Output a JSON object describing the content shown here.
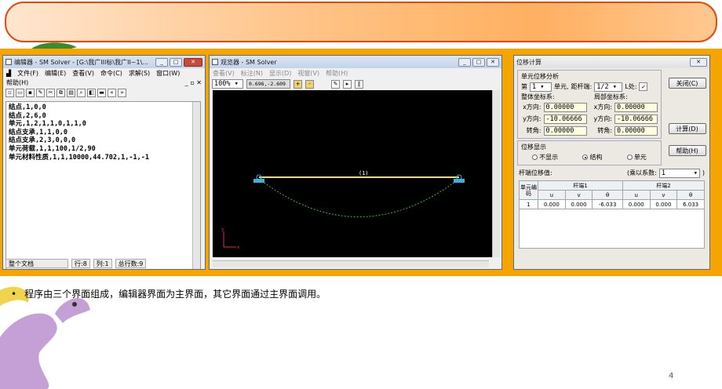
{
  "slide": {
    "bullet_text": "程序由三个界面组成，编辑器界面为主界面，其它界面通过主界面调用。",
    "page_number": "4",
    "colors": {
      "strip": "#f6a400",
      "title_border": "#e04a10",
      "dino": "#c5a0d6"
    }
  },
  "editor": {
    "title": "编辑器 - SM Solver - [G:\\我广III标\\我广II~1\\...",
    "menu": [
      "文件(F)",
      "编辑(E)",
      "查看(V)",
      "命令(C)",
      "求解(S)",
      "窗口(W)"
    ],
    "menu2": "帮助(H)",
    "lines": [
      "结点,1,0,0",
      "结点,2,6,0",
      "单元,1,2,1,1,0,1,1,0",
      "结点支承,1,1,0,0",
      "结点支承,2,3,0,0,0",
      "单元荷载,1,1,100,1/2,90",
      "单元材料性质,1,1,10000,44.702,1,-1,-1"
    ],
    "status": {
      "doc": "整个文档",
      "row": "行:8",
      "col": "列:1",
      "total": "总行数:9"
    }
  },
  "viewer": {
    "title": "观览器 - SM Solver",
    "menu": [
      "查看(V)",
      "标注(N)",
      "显示(D)",
      "视窗(V)",
      "帮助(H)"
    ],
    "zoom": "100%",
    "coords": "0.696,-2.609",
    "element_label": "(1)",
    "axis_y": "y",
    "axis_x": "x"
  },
  "calc": {
    "title": "位移计算",
    "group1_title": "单元位移分析",
    "elem_prefix": "第",
    "elem_value": "1",
    "elem_suffix": "单元,",
    "dist_label": "距杆端:",
    "dist_value": "1/2",
    "l_label": "L处:",
    "global_title": "整体坐标系:",
    "local_title": "局部坐标系:",
    "x_label": "x方向:",
    "y_label": "y方向:",
    "rot_label": "转角:",
    "gx": "0.00000",
    "gy": "-10.06666",
    "grot": "0.00000",
    "lx": "0.00000",
    "ly": "-10.06666",
    "lrot": "0.00000",
    "btn_close": "关闭(C)",
    "btn_calc": "计算(D)",
    "btn_help": "帮助(H)",
    "group2_title": "位移显示",
    "radios": [
      "不显示",
      "结构",
      "单元"
    ],
    "disp_label": "杆端位移值:",
    "scale_label": "(乘以系数:",
    "scale_value": "1",
    "table": {
      "h_unit": "单元编码",
      "h_end1": "杆端1",
      "h_end2": "杆端2",
      "cols": [
        "u",
        "v",
        "θ",
        "u",
        "v",
        "θ"
      ],
      "row": [
        "1",
        "0.000",
        "0.000",
        "-6.033",
        "0.000",
        "0.000",
        "6.033"
      ]
    }
  }
}
